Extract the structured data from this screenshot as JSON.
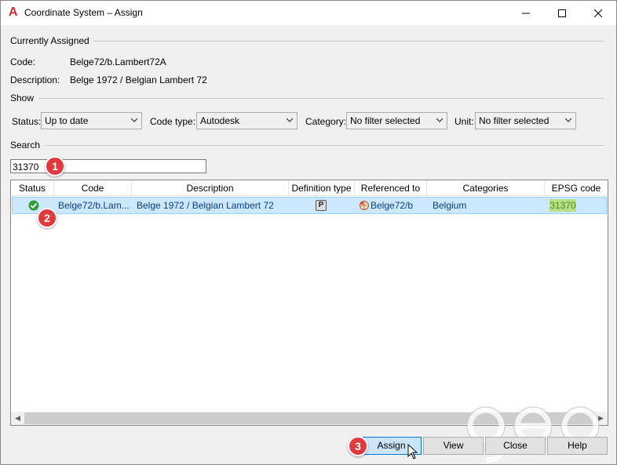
{
  "window": {
    "title": "Coordinate System – Assign",
    "app_icon": "autocad-a-icon"
  },
  "currently_assigned": {
    "section_label": "Currently Assigned",
    "code_label": "Code:",
    "code_value": "Belge72/b.Lambert72A",
    "description_label": "Description:",
    "description_value": "Belge 1972 / Belgian Lambert 72"
  },
  "show": {
    "section_label": "Show",
    "status_label": "Status:",
    "status_value": "Up to date",
    "code_type_label": "Code type:",
    "code_type_value": "Autodesk",
    "category_label": "Category:",
    "category_value": "No filter selected",
    "unit_label": "Unit:",
    "unit_value": "No filter selected"
  },
  "search": {
    "section_label": "Search",
    "value": "31370"
  },
  "table": {
    "columns": [
      "Status",
      "Code",
      "Description",
      "Definition type",
      "Referenced to",
      "Categories",
      "EPSG code"
    ],
    "rows": [
      {
        "status_icon": "green-check-icon",
        "code": "Belge72/b.Lam...",
        "description": "Belge 1972 / Belgian Lambert 72",
        "definition_type": "P",
        "referenced_to": "Belge72/b",
        "categories": "Belgium",
        "epsg_code": "31370"
      }
    ]
  },
  "buttons": {
    "assign": "Assign",
    "view": "View",
    "close": "Close",
    "help": "Help"
  },
  "annotations": [
    "1",
    "2",
    "3"
  ],
  "colors": {
    "selection": "#cce8ff",
    "badge": "#e0393e",
    "epsg_highlight": "#b5e08a",
    "primary_button": "#cce4f7"
  }
}
